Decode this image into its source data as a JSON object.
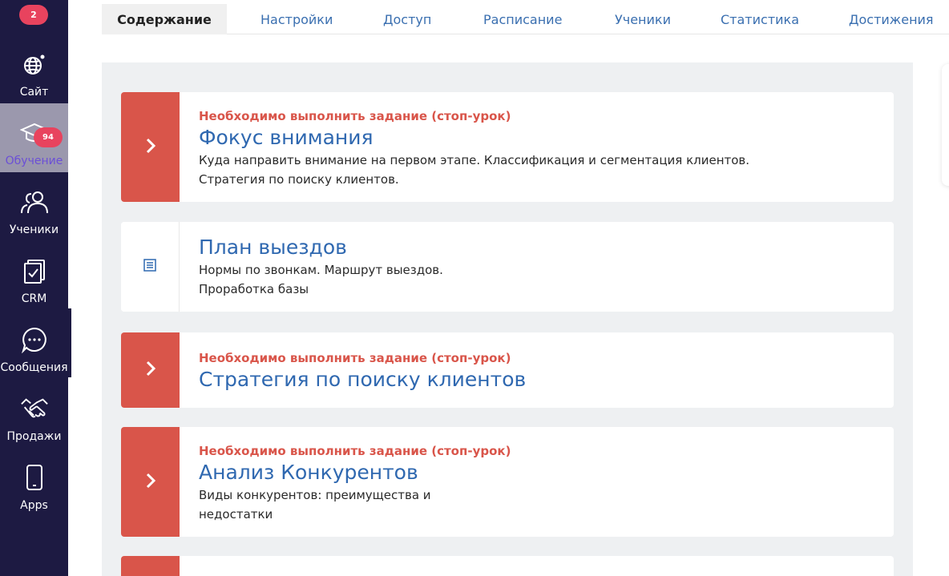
{
  "sidebar": {
    "top_badge": "2",
    "items": [
      {
        "label": "Сайт",
        "icon": "globe-icon"
      },
      {
        "label": "Обучение",
        "icon": "graduation-cap-icon",
        "badge": "94",
        "active": true
      },
      {
        "label": "Ученики",
        "icon": "users-icon"
      },
      {
        "label": "CRM",
        "icon": "clipboard-check-icon"
      },
      {
        "label": "Сообщения",
        "icon": "chat-bubble-icon"
      },
      {
        "label": "Продажи",
        "icon": "handshake-icon"
      },
      {
        "label": "Apps",
        "icon": "phone-icon"
      }
    ]
  },
  "tabs": [
    {
      "label": "Содержание",
      "active": true
    },
    {
      "label": "Настройки"
    },
    {
      "label": "Доступ"
    },
    {
      "label": "Расписание"
    },
    {
      "label": "Ученики"
    },
    {
      "label": "Статистика"
    },
    {
      "label": "Достижения"
    }
  ],
  "lessons": [
    {
      "stop_label": "Необходимо выполнить задание (стоп-урок)",
      "title": "Фокус внимания",
      "desc": [
        "Куда направить внимание на первом этапе. Классификация и сегментация клиентов.",
        "Стратегия по поиску клиентов."
      ],
      "stop": true
    },
    {
      "title": "План выездов",
      "desc": [
        "Нормы по звонкам. Маршрут выездов.",
        "Проработка базы"
      ],
      "stop": false
    },
    {
      "stop_label": "Необходимо выполнить задание (стоп-урок)",
      "title": "Стратегия по поиску клиентов",
      "desc": [],
      "stop": true
    },
    {
      "stop_label": "Необходимо выполнить задание (стоп-урок)",
      "title": "Анализ Конкурентов",
      "desc": [
        "Виды конкурентов: преимущества и",
        "недостатки"
      ],
      "stop": true
    }
  ],
  "colors": {
    "sidebar_bg": "#1d1a42",
    "badge": "#e8435e",
    "stop_red": "#d9554a",
    "title_blue": "#2f68b0",
    "active_purple": "#6b4fd6"
  }
}
